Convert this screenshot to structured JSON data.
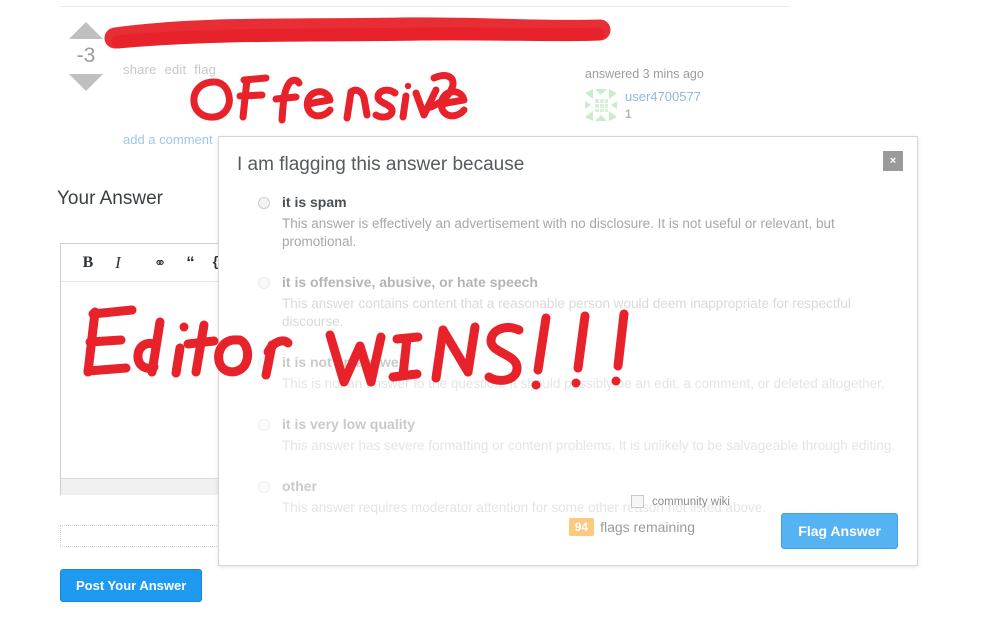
{
  "post": {
    "vote_count": "-3",
    "links": [
      "share",
      "edit",
      "flag"
    ],
    "add_comment": "add a comment",
    "answered_when": "answered 3 mins ago",
    "user_name": "user4700577",
    "user_reputation": "1"
  },
  "answer_form": {
    "heading": "Your Answer",
    "submit_label": "Post Your Answer",
    "toolbar": [
      {
        "name": "bold",
        "glyph": "B"
      },
      {
        "name": "italic",
        "glyph": "I"
      },
      {
        "name": "hyperlink",
        "glyph": "⚭"
      },
      {
        "name": "blockquote",
        "glyph": "“"
      },
      {
        "name": "code-sample",
        "glyph": "{}"
      },
      {
        "name": "image",
        "glyph": "▣"
      },
      {
        "name": "html",
        "glyph": "<>"
      },
      {
        "name": "numbered-list",
        "glyph": "≡"
      },
      {
        "name": "bulleted-list",
        "glyph": "≡"
      },
      {
        "name": "heading",
        "glyph": "—"
      },
      {
        "name": "horizontal-rule",
        "glyph": "—"
      }
    ],
    "help_glyph": "?"
  },
  "modal": {
    "title": "I am flagging this answer because",
    "close_glyph": "×",
    "options": [
      {
        "label": "it is spam",
        "description": "This answer is effectively an advertisement with no disclosure. It is not useful or relevant, but promotional."
      },
      {
        "label": "it is offensive, abusive, or hate speech",
        "description": "This answer contains content that a reasonable person would deem inappropriate for respectful discourse."
      },
      {
        "label": "it is not an answer",
        "description": "This is not an answer to the question. It should possibly be an edit, a comment, or deleted altogether."
      },
      {
        "label": "it is very low quality",
        "description": "This answer has severe formatting or content problems. It is unlikely to be salvageable through editing."
      },
      {
        "label": "other",
        "description": "This answer requires moderator attention for some other reason not listed above."
      }
    ],
    "community_wiki_label": "community wiki",
    "flags_remaining_count": "94",
    "flags_remaining_label": "flags remaining",
    "submit_label": "Flag Answer"
  },
  "annotations": {
    "marker_color": "#e8222a",
    "redaction_bar": "",
    "offensive_scribble": "OFfeNsive",
    "editor_wins_scribble": "Editor WINS!!!"
  }
}
